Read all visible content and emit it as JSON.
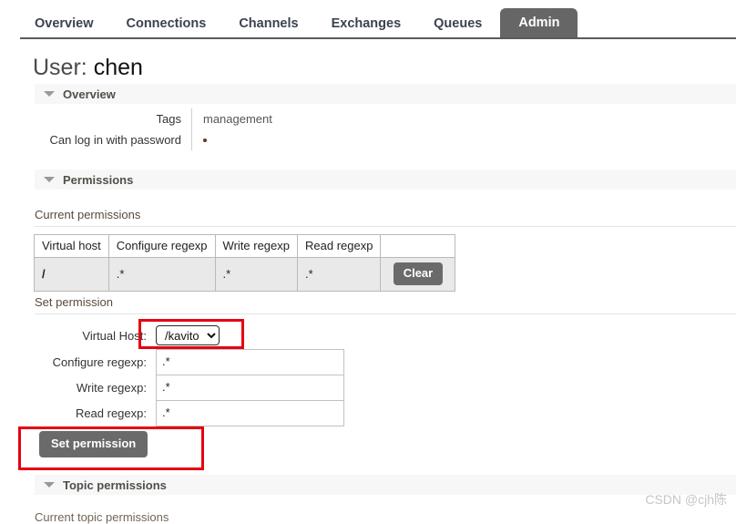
{
  "nav": {
    "tabs": [
      {
        "label": "Overview",
        "active": false
      },
      {
        "label": "Connections",
        "active": false
      },
      {
        "label": "Channels",
        "active": false
      },
      {
        "label": "Exchanges",
        "active": false
      },
      {
        "label": "Queues",
        "active": false
      },
      {
        "label": "Admin",
        "active": true
      }
    ]
  },
  "page": {
    "title_label": "User:",
    "title_value": "chen"
  },
  "overview": {
    "section_label": "Overview",
    "rows": [
      {
        "key": "Tags",
        "value": "management"
      },
      {
        "key": "Can log in with password",
        "value": "•"
      }
    ]
  },
  "permissions": {
    "section_label": "Permissions",
    "current_label": "Current permissions",
    "table": {
      "headers": [
        "Virtual host",
        "Configure regexp",
        "Write regexp",
        "Read regexp",
        ""
      ],
      "rows": [
        {
          "virtual_host": "/",
          "configure": ".*",
          "write": ".*",
          "read": ".*",
          "action": "Clear"
        }
      ]
    },
    "set_label": "Set permission",
    "form": {
      "vhost_label": "Virtual Host:",
      "vhost_value": "/kavito",
      "vhost_options": [
        "/kavito"
      ],
      "configure_label": "Configure regexp:",
      "configure_value": ".*",
      "write_label": "Write regexp:",
      "write_value": ".*",
      "read_label": "Read regexp:",
      "read_value": ".*",
      "submit_label": "Set permission"
    }
  },
  "topic_permissions": {
    "section_label": "Topic permissions",
    "current_label": "Current topic permissions"
  },
  "watermark": {
    "text": "CSDN @cjh陈"
  },
  "colors": {
    "accent_red": "#e60012",
    "button_gray": "#6a6a6a",
    "active_tab": "#666666",
    "section_bar": "#f7f7f7"
  }
}
